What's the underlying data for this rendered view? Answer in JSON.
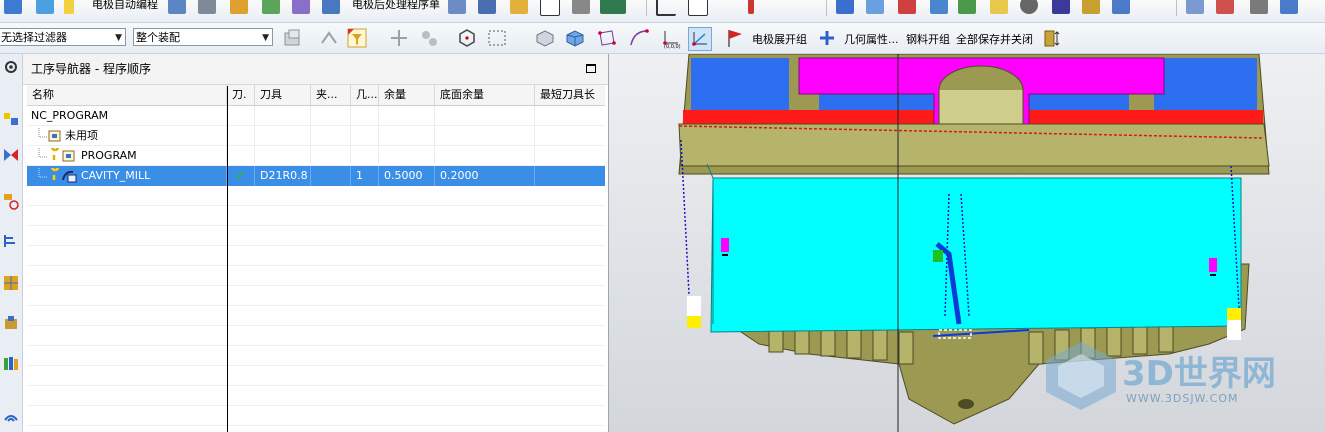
{
  "toolbar_top": {
    "electrode_auto_program": "电极自动编程",
    "electrode_post_process": "电极后处理程序单"
  },
  "toolbar_second": {
    "filter_combo": "无选择过滤器",
    "assembly_combo": "整个装配",
    "electrode_expand_group": "电极展开组",
    "geometry_props": "几何属性...",
    "steel_open_group": "钢料开组",
    "save_all_close": "全部保存并关闭"
  },
  "navigator": {
    "title": "工序导航器 - 程序顺序",
    "columns": [
      "名称",
      "刀.",
      "刀具",
      "夹...",
      "几...",
      "余量",
      "底面余量",
      "最短刀具长"
    ],
    "rows": [
      {
        "name": "NC_PROGRAM",
        "tool_change": "",
        "tool": "",
        "holder": "",
        "geom": "",
        "stock": "",
        "floor_stock": "",
        "min_len": ""
      },
      {
        "name": "未用项",
        "tool_change": "",
        "tool": "",
        "holder": "",
        "geom": "",
        "stock": "",
        "floor_stock": "",
        "min_len": ""
      },
      {
        "name": "PROGRAM",
        "tool_change": "",
        "tool": "",
        "holder": "",
        "geom": "",
        "stock": "",
        "floor_stock": "",
        "min_len": ""
      },
      {
        "name": "CAVITY_MILL",
        "tool_change": "✔",
        "tool": "D21R0.8",
        "holder": "",
        "geom": "1",
        "stock": "0.5000",
        "floor_stock": "0.2000",
        "min_len": ""
      }
    ],
    "selected_row": 3
  },
  "watermark": {
    "brand": "3D世界网",
    "url": "WWW.3DSJW.COM"
  },
  "colors": {
    "selection": "#3a8ee6",
    "part_cyan": "#00ffff",
    "part_magenta": "#ff00ff",
    "part_blue": "#2e6ef0",
    "part_red": "#ff1a1a",
    "part_olive": "#9c9a52"
  }
}
